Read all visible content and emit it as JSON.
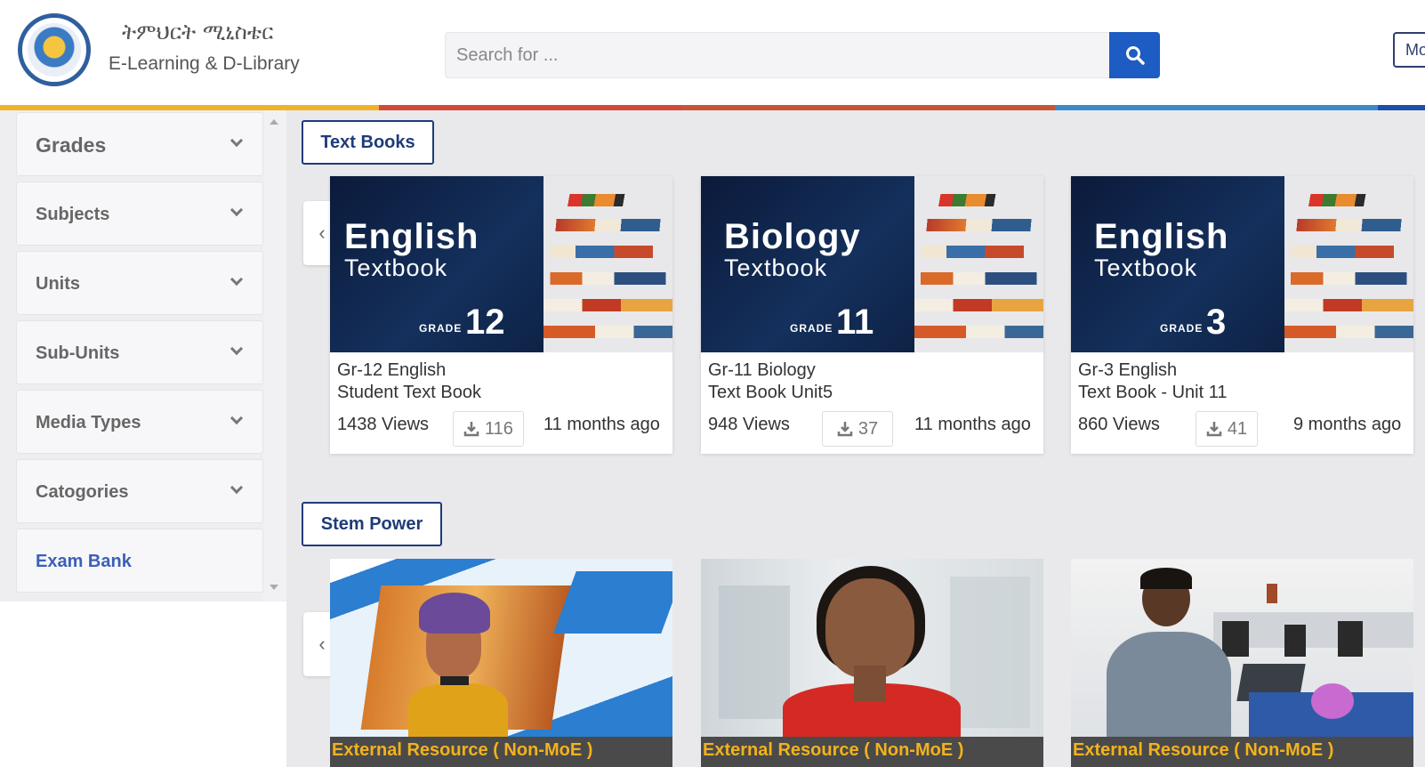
{
  "header": {
    "brand_amharic": "ትምህርት ሚኒስቴር",
    "brand_english": "E-Learning & D-Library",
    "search_placeholder": "Search for ...",
    "more_button": "Mo",
    "colorbar": [
      "#f2b227",
      "#d2493a",
      "#c85437",
      "#3b8bc9",
      "#1d4fa8"
    ]
  },
  "sidebar": {
    "filters": [
      {
        "label": "Grades"
      },
      {
        "label": "Subjects"
      },
      {
        "label": "Units"
      },
      {
        "label": "Sub-Units"
      },
      {
        "label": "Media Types"
      },
      {
        "label": "Catogories"
      }
    ],
    "exam_bank": "Exam Bank"
  },
  "sections": {
    "textbooks": {
      "title": "Text Books",
      "cards": [
        {
          "cover_subject": "English",
          "cover_type": "Textbook",
          "cover_grade_label": "GRADE",
          "cover_grade": "12",
          "title_line1": "Gr-12 English",
          "title_line2": "Student Text Book",
          "views": "1438 Views",
          "downloads": "116",
          "age": "11 months ago"
        },
        {
          "cover_subject": "Biology",
          "cover_type": "Textbook",
          "cover_grade_label": "GRADE",
          "cover_grade": "11",
          "title_line1": "Gr-11 Biology",
          "title_line2": "Text Book Unit5",
          "views": "948 Views",
          "downloads": "37",
          "age": "11 months ago"
        },
        {
          "cover_subject": "English",
          "cover_type": "Textbook",
          "cover_grade_label": "GRADE",
          "cover_grade": "3",
          "title_line1": "Gr-3 English",
          "title_line2": "Text Book - Unit 11",
          "views": "860 Views",
          "downloads": "41",
          "age": "9 months ago"
        }
      ]
    },
    "stem": {
      "title": "Stem Power",
      "cards": [
        {
          "label": "External Resource ( Non-MoE )"
        },
        {
          "label": "External Resource ( Non-MoE )"
        },
        {
          "label": "External Resource ( Non-MoE )"
        }
      ]
    }
  },
  "icons": {
    "search": "search-icon",
    "download": "download-icon",
    "chevron_down": "chevron-down-icon",
    "chevron_left": "chevron-left-icon"
  },
  "colors": {
    "accent_blue": "#1d5cc2",
    "navy": "#1f3b7a",
    "resource_label": "#f2b21d"
  }
}
